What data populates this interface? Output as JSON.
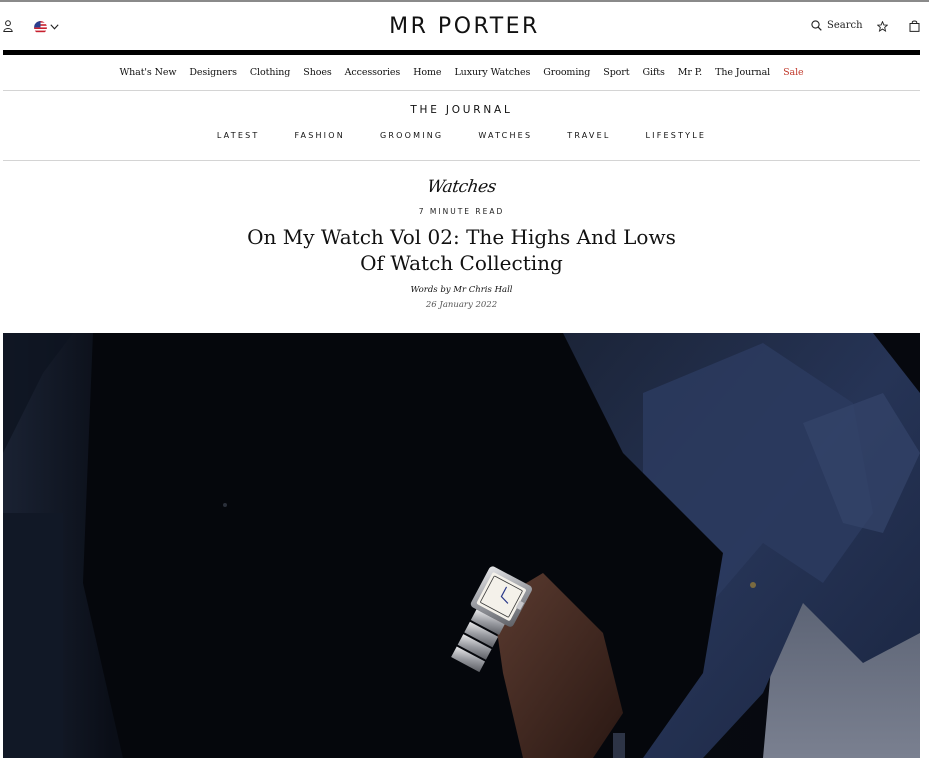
{
  "header": {
    "logo": "MR PORTER",
    "search_label": "Search",
    "country_flag": "US"
  },
  "main_nav": [
    {
      "label": "What's New"
    },
    {
      "label": "Designers"
    },
    {
      "label": "Clothing"
    },
    {
      "label": "Shoes"
    },
    {
      "label": "Accessories"
    },
    {
      "label": "Home"
    },
    {
      "label": "Luxury Watches"
    },
    {
      "label": "Grooming"
    },
    {
      "label": "Sport"
    },
    {
      "label": "Gifts"
    },
    {
      "label": "Mr P."
    },
    {
      "label": "The Journal"
    },
    {
      "label": "Sale",
      "color": "#c0392b"
    }
  ],
  "journal": {
    "title": "THE JOURNAL",
    "nav": [
      "LATEST",
      "FASHION",
      "GROOMING",
      "WATCHES",
      "TRAVEL",
      "LIFESTYLE"
    ]
  },
  "article": {
    "category": "Watches",
    "read_time": "7 MINUTE READ",
    "headline_line1": "On My Watch Vol 02: The Highs And Lows",
    "headline_line2": "Of Watch Collecting",
    "byline": "Words by Mr Chris Hall",
    "date": "26 January 2022"
  },
  "icons": {
    "account": "account-icon",
    "flag": "us-flag-icon",
    "chevron": "chevron-down-icon",
    "search": "search-icon",
    "wishlist": "star-icon",
    "bag": "shopping-bag-icon"
  },
  "colors": {
    "sale": "#c0392b",
    "rule": "#d4d4d4",
    "hero_background": "#070a12"
  }
}
